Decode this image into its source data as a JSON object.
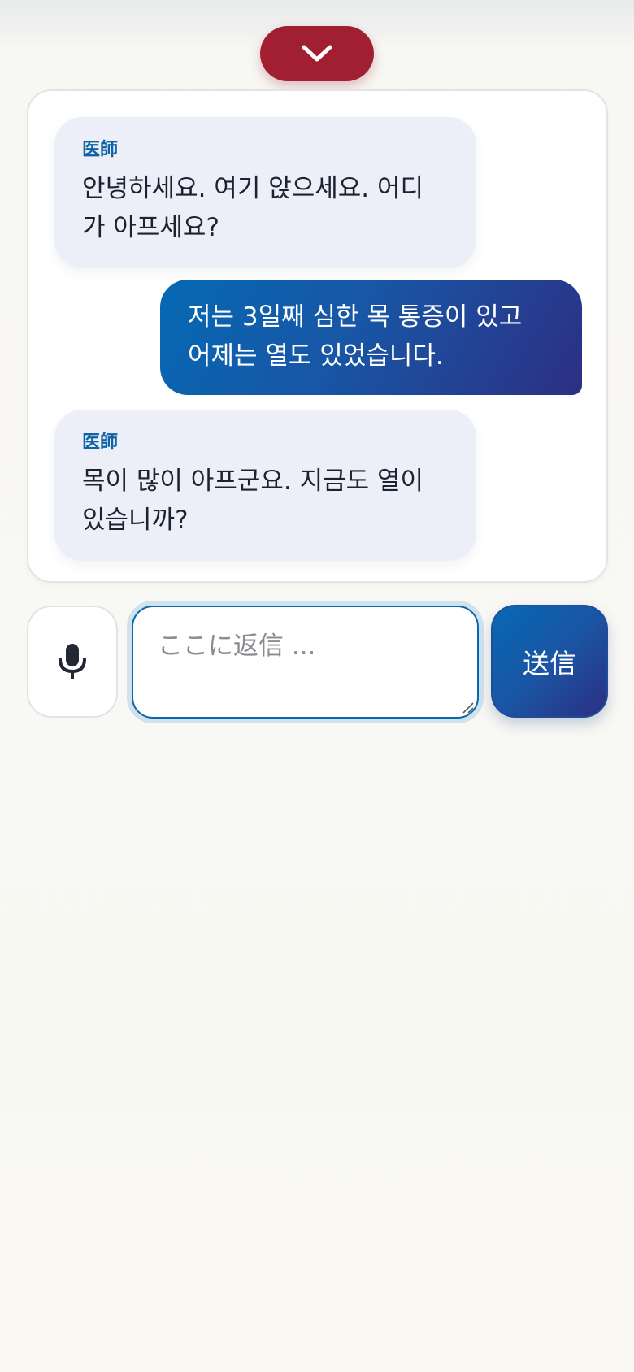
{
  "header": {
    "collapse_icon": "chevron-down-icon"
  },
  "chat": {
    "messages": [
      {
        "role": "doctor",
        "sender": "医師",
        "text": "안녕하세요. 여기 앉으세요. 어디가 아프세요?",
        "lines": [
          "안녕하세요. 여기 앉으세요. 어디",
          "가 아프세요?"
        ]
      },
      {
        "role": "user",
        "sender": "",
        "text": "저는 3일째 심한 목 통증이 있고 어제는 열도 있었습니다.",
        "lines": [
          "저는 3일째 심한 목 통증이 있고",
          "어제는 열도 있었습니다."
        ]
      },
      {
        "role": "doctor",
        "sender": "医師",
        "text": "목이 많이 아프군요. 지금도 열이 있습니까?",
        "lines": [
          "목이 많이 아프군요. 지금도 열이",
          "있습니까?"
        ]
      }
    ]
  },
  "composer": {
    "mic_icon": "microphone-icon",
    "placeholder": "ここに返信 ...",
    "value": "",
    "send_label": "送信"
  },
  "colors": {
    "doctor_accent": "#0e63a4",
    "collapse_button": "#a02032",
    "user_bubble_start": "#0569b3",
    "user_bubble_end": "#2d2f82"
  }
}
